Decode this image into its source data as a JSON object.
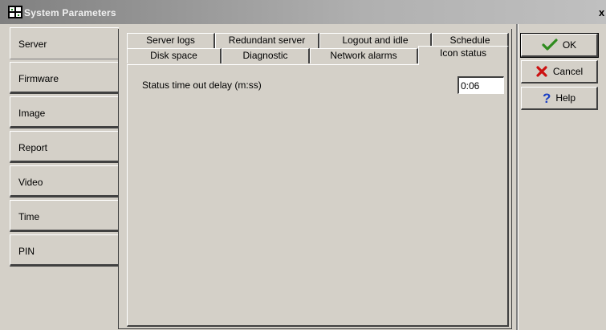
{
  "window": {
    "title": "System Parameters",
    "close_label": "x"
  },
  "sidebar": {
    "items": [
      {
        "label": "Server",
        "active": true
      },
      {
        "label": "Firmware"
      },
      {
        "label": "Image"
      },
      {
        "label": "Report"
      },
      {
        "label": "Video"
      },
      {
        "label": "Time"
      },
      {
        "label": "PIN"
      }
    ]
  },
  "tabs": {
    "row1": [
      "Server logs",
      "Redundant server",
      "Logout and idle",
      "Schedule"
    ],
    "row2": [
      "Disk space",
      "Diagnostic",
      "Network alarms",
      "Icon status"
    ],
    "active": "Icon status"
  },
  "panel": {
    "label": "Status time out delay (m:ss)",
    "value": "0:06"
  },
  "buttons": {
    "ok": "OK",
    "cancel": "Cancel",
    "help": "Help"
  },
  "icons": {
    "ok": "checkmark-icon",
    "cancel": "x-icon",
    "help": "question-icon"
  },
  "colors": {
    "face": "#d4d0c8",
    "ok_icon": "#2e8b1e",
    "cancel_icon": "#cc1111",
    "help_icon": "#1a3fc4"
  }
}
